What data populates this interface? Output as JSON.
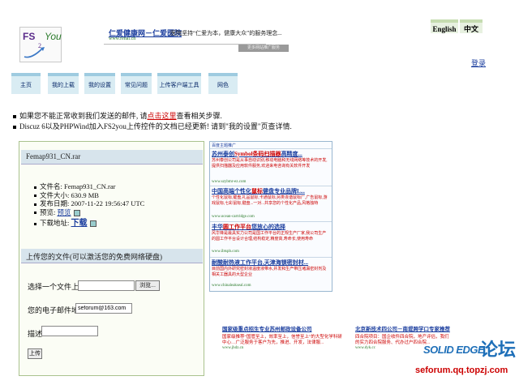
{
  "colors": {
    "nav_bg": "#d9ecf3",
    "panel_band": "#d7e4ec",
    "link_blue": "#1a3d9e",
    "ad_red": "#cc0000",
    "ad_green": "#2a7a2a",
    "watermark_blue": "#1e6fb8"
  },
  "logo": {
    "fs": "FS",
    "two": "2",
    "you": "You"
  },
  "top_ad": {
    "title": "仁爱健康网－仁爱医院",
    "desc": "医院坚持“仁爱为本，健康大众”的服务理念...",
    "url": "www.renai.cn",
    "more": "更多网站推广服务"
  },
  "lang": {
    "en": "English",
    "zh": "中文"
  },
  "login": "登录",
  "nav": [
    "主页",
    "我的上载",
    "我的设置",
    "常见问题",
    "上传客户端工具",
    "网色"
  ],
  "notices": {
    "n1_pre": "如果您不能正常收到我们发送的邮件, 请",
    "n1_link": "点击这里",
    "n1_post": "查看相关步骤.",
    "n2": "Discuz 6以及PHPWind加入FS2you上传控件的文档已经更新! 请到\"我的设置\"页查详情."
  },
  "file_panel": {
    "name": "Femap931_CN.rar",
    "filename_label": "文件名: Femap931_CN.rar",
    "size_label": "文件大小:    630.9 MB",
    "date_label": "发布日期: 2007-11-22 19:56:47 UTC",
    "preview_label": "预览:",
    "preview_link": "预览",
    "download_label": "下载地址:",
    "download_link": "下载"
  },
  "upload_panel": {
    "title": "上传您的文件(可以激活您的免费网络硬盘)",
    "choose_label": "选择一个文件上传:",
    "browse": "浏览...",
    "email_label": "您的电子邮件地址:",
    "email_value": "seforum@163.com",
    "desc_label": "描述:",
    "desc_value": "",
    "upload": "上传"
  },
  "side_ads": {
    "header": "百度主题推广",
    "items": [
      {
        "t1": "苏州泰创",
        "t2": "Symbol条码扫描器",
        "t3": "高精度...",
        "d": "苏州泰创公司是从事自动识别,移动电脑和无线网络等技术的开发,提供扫描器及应用软件服务,欢迎来电咨询有关软件开发",
        "u": "www.szybmr-ez.com"
      },
      {
        "t1": "中国高端个性化",
        "t2": "鼠标",
        "t3": "健盘专业品牌L...",
        "d": "个性化鼠标,键盘,礼品鼠标,卡通鼠标,另类诙谐鼠标厂,广告鼠标,游戏鼠标,七彩鼠标,键盘...一对...共享您的个性化产品,风格独特",
        "u": "www.ocean-cartridge.com"
      },
      {
        "t1": "丰华",
        "t2": "圆工作平台",
        "t3": "您放心的选择",
        "d": "风华锋是最具实力公司是国工作平台的正规生产厂家,我公司生产的圆工作平台设计合理,结构稳定,精度高,寿命长,使用寿命",
        "u": "www.ibtspb.com"
      },
      {
        "t1": "耐酸耐热液工作平台,天津",
        "t2": "",
        "t3": "海镁密封材...",
        "d": "目前国内外研究密封液温度液带水,并发和生产带压堵漏密封剂及相关工器具的大型企业",
        "u": "www.chinaleakseal.com"
      }
    ]
  },
  "bottom_ads": [
    {
      "t": "国家级重点招生专业苏州邮政设备公司",
      "d": "国家级推荐“国管至上，效率至上，信誉至上”的大型化学科研中心…广泛服务于客户为先，推进、开发，法律服...",
      "u": "www.jhdz.cn"
    },
    {
      "t": "北京新技术四公司－南堤跨学口专家推荐",
      "d": "四合院项目：国企收件四合院，地产评估，我们的实力四合院服务、代办过户四合院...",
      "u": "www.dyk.cc"
    }
  ],
  "watermark": {
    "brand": "SOLID EDGE",
    "cn": "论坛",
    "url": "seforum.qq.topzj.com"
  }
}
